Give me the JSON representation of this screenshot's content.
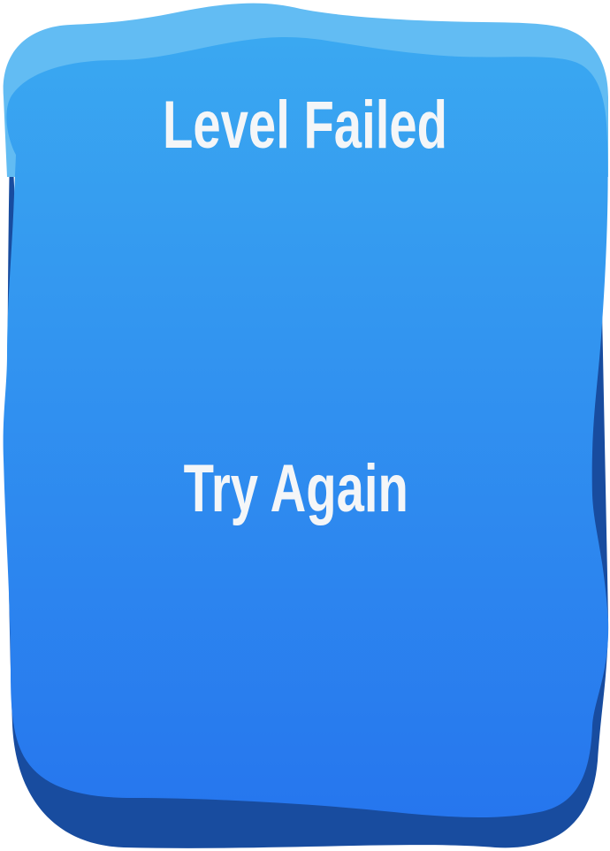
{
  "dialog": {
    "title": "Level Failed",
    "retry_label": "Try Again"
  },
  "colors": {
    "panel_top": "#3aa6f0",
    "panel_bottom": "#2677ee",
    "panel_rim_top": "#62bdf3",
    "panel_shadow": "#1a4fa0",
    "text": "#f4f6f8"
  }
}
